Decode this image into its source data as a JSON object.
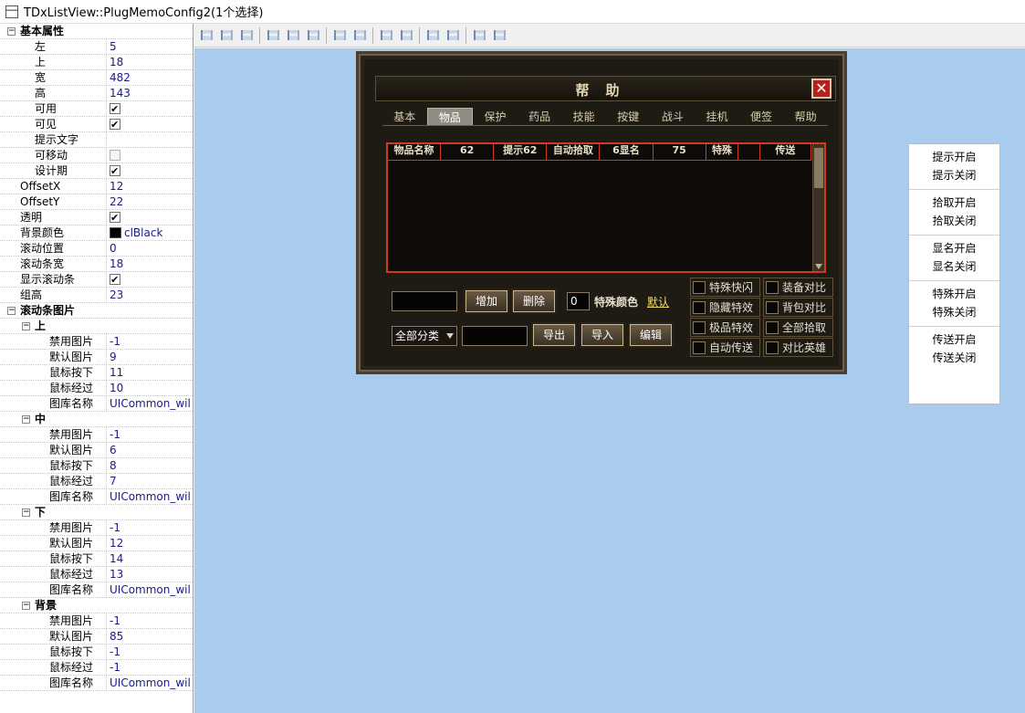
{
  "window": {
    "title": "TDxListView::PlugMemoConfig2(1个选择)"
  },
  "props": {
    "basic_group": "基本属性",
    "rows": [
      {
        "name": "左",
        "value": "5"
      },
      {
        "name": "上",
        "value": "18"
      },
      {
        "name": "宽",
        "value": "482"
      },
      {
        "name": "高",
        "value": "143"
      },
      {
        "name": "可用",
        "check": true
      },
      {
        "name": "可见",
        "check": true
      },
      {
        "name": "提示文字",
        "value": ""
      },
      {
        "name": "可移动",
        "check": false
      },
      {
        "name": "设计期",
        "check": true
      }
    ],
    "rows2": [
      {
        "name": "OffsetX",
        "value": "12"
      },
      {
        "name": "OffsetY",
        "value": "22"
      },
      {
        "name": "透明",
        "check": true
      },
      {
        "name": "背景颜色",
        "value": "clBlack",
        "swatch": "#000000"
      },
      {
        "name": "滚动位置",
        "value": "0"
      },
      {
        "name": "滚动条宽",
        "value": "18"
      },
      {
        "name": "显示滚动条",
        "check": true
      },
      {
        "name": "组高",
        "value": "23"
      }
    ],
    "scroll_group": "滚动条图片",
    "sub_top": "上",
    "top_rows": [
      {
        "name": "禁用图片",
        "value": "-1"
      },
      {
        "name": "默认图片",
        "value": "9"
      },
      {
        "name": "鼠标按下",
        "value": "11"
      },
      {
        "name": "鼠标经过",
        "value": "10"
      },
      {
        "name": "图库名称",
        "value": "UICommon_wil"
      }
    ],
    "sub_mid": "中",
    "mid_rows": [
      {
        "name": "禁用图片",
        "value": "-1"
      },
      {
        "name": "默认图片",
        "value": "6"
      },
      {
        "name": "鼠标按下",
        "value": "8"
      },
      {
        "name": "鼠标经过",
        "value": "7"
      },
      {
        "name": "图库名称",
        "value": "UICommon_wil"
      }
    ],
    "sub_bot": "下",
    "bot_rows": [
      {
        "name": "禁用图片",
        "value": "-1"
      },
      {
        "name": "默认图片",
        "value": "12"
      },
      {
        "name": "鼠标按下",
        "value": "14"
      },
      {
        "name": "鼠标经过",
        "value": "13"
      },
      {
        "name": "图库名称",
        "value": "UICommon_wil"
      }
    ],
    "sub_bg": "背景",
    "bg_rows": [
      {
        "name": "禁用图片",
        "value": "-1"
      },
      {
        "name": "默认图片",
        "value": "85"
      },
      {
        "name": "鼠标按下",
        "value": "-1"
      },
      {
        "name": "鼠标经过",
        "value": "-1"
      },
      {
        "name": "图库名称",
        "value": "UICommon_wil"
      }
    ]
  },
  "game": {
    "title": "帮助",
    "close": "✕",
    "tabs": [
      "基本",
      "物品",
      "保护",
      "药品",
      "技能",
      "按键",
      "战斗",
      "挂机",
      "便签",
      "帮助"
    ],
    "active_tab": 1,
    "columns": [
      "物品名称",
      "62",
      "提示62",
      "自动拾取",
      "6显名",
      "75",
      "特殊",
      "",
      "传送"
    ],
    "add_btn": "增加",
    "del_btn": "删除",
    "color_value": "0",
    "color_label": "特殊颜色",
    "default_link": "默认",
    "category": "全部分类",
    "export_btn": "导出",
    "import_btn": "导入",
    "edit_btn": "编辑",
    "options": [
      "特殊快闪",
      "装备对比",
      "隐藏特效",
      "背包对比",
      "极品特效",
      "全部拾取",
      "自动传送",
      "对比英雄"
    ]
  },
  "menu": {
    "groups": [
      [
        "提示开启",
        "提示关闭"
      ],
      [
        "拾取开启",
        "拾取关闭"
      ],
      [
        "显名开启",
        "显名关闭"
      ],
      [
        "特殊开启",
        "特殊关闭"
      ],
      [
        "传送开启",
        "传送关闭"
      ]
    ]
  }
}
